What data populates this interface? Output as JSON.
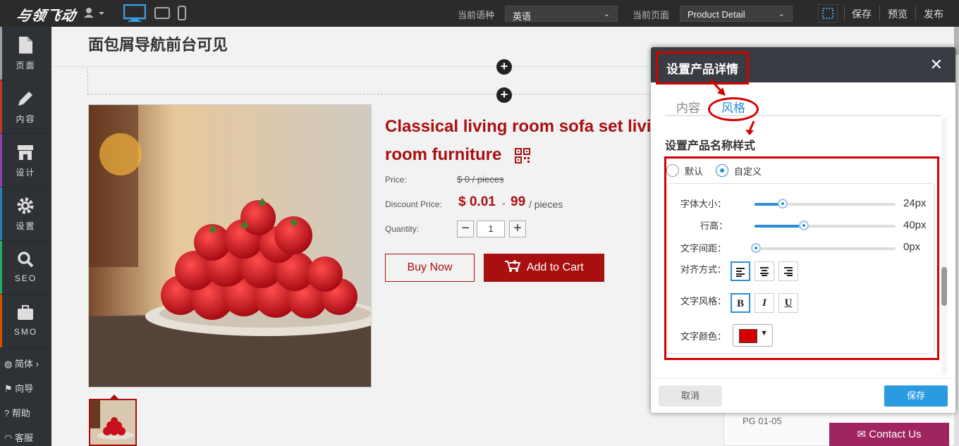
{
  "topbar": {
    "logo": "与领飞动",
    "language_label": "当前语种",
    "language_value": "英语",
    "page_label": "当前页面",
    "page_value": "Product Detail",
    "save": "保存",
    "preview": "预览",
    "publish": "发布"
  },
  "sidebar": {
    "items": [
      {
        "label": "页面",
        "icon": "page-icon",
        "color": "#9aa0a6"
      },
      {
        "label": "内容",
        "icon": "pen-icon",
        "color": "#c0392b"
      },
      {
        "label": "设计",
        "icon": "store-icon",
        "color": "#8e44ad"
      },
      {
        "label": "设置",
        "icon": "gear-icon",
        "color": "#2980b9"
      },
      {
        "label": "SEO",
        "icon": "search-icon",
        "color": "#27ae60"
      },
      {
        "label": "SMO",
        "icon": "briefcase-icon",
        "color": "#d35400"
      }
    ],
    "bottom": [
      {
        "label": "简体 ›",
        "icon": "globe-icon"
      },
      {
        "label": "向导",
        "icon": "flag-icon"
      },
      {
        "label": "帮助",
        "icon": "help-icon"
      },
      {
        "label": "客服",
        "icon": "headset-icon"
      }
    ]
  },
  "canvas": {
    "breadcrumb_title": "面包屑导航前台可见",
    "product_title_line1": "Classical living room sofa set livi",
    "product_title_line2": "room furniture",
    "price_label": "Price:",
    "price_old": "$ 0 / pieces",
    "discount_label": "Discount Price:",
    "discount_min": "$ 0.01",
    "discount_dash": "-",
    "discount_max": "99",
    "discount_unit": "/ pieces",
    "quantity_label": "Quantity:",
    "quantity_value": "1",
    "buy_now": "Buy Now",
    "add_to_cart": "Add to Cart",
    "pg_text": "PG 01-05",
    "contact_us": "Contact Us"
  },
  "dialog": {
    "title": "设置产品详情",
    "tabs": [
      "内容",
      "风格"
    ],
    "active_tab": "风格",
    "section_title": "设置产品名称样式",
    "radio_default": "默认",
    "radio_custom": "自定义",
    "font_size_label": "字体大小：",
    "font_size_value": "24px",
    "font_size_level": 0.19,
    "line_height_label": "行高：",
    "line_height_value": "40px",
    "line_height_level": 0.34,
    "letter_spacing_label": "文字间距：",
    "letter_spacing_value": "0px",
    "letter_spacing_level": 0,
    "align_label": "对齐方式：",
    "style_label": "文字风格：",
    "color_label": "文字颜色：",
    "text_color": "#d40000",
    "bold": "B",
    "italic": "I",
    "underline": "U",
    "cancel": "取消",
    "save": "保存"
  },
  "colors": {
    "accent_red": "#a81010",
    "annotation_red": "#d40000",
    "blue": "#2a8fd6",
    "topbar": "#2b2b2b",
    "sidebar": "#2e3136"
  }
}
